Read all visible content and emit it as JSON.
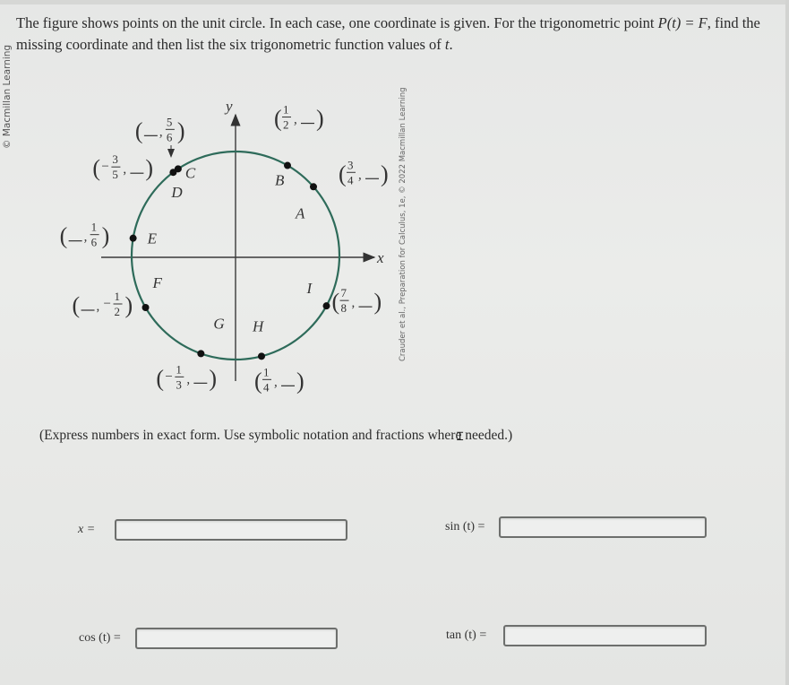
{
  "prompt": {
    "part1": "The figure shows points on the unit circle. In each case, one coordinate is given. For the trigonometric point ",
    "math_point": "P(t) = F",
    "part2": ", find the missing coordinate and then list the six trigonometric function values of ",
    "math_var": "t",
    "part3": "."
  },
  "side_credit": "© Macmillan Learning",
  "figure": {
    "credit": "Crauder et al., Preparation for Calculus, 1e, © 2022 Macmillan Learning",
    "x_axis_label": "x",
    "y_axis_label": "y",
    "circle_color": "#2e6b5a",
    "points": [
      {
        "name": "A",
        "given": "x",
        "label": "(3/4, __)",
        "num": "3",
        "den": "4",
        "sign": ""
      },
      {
        "name": "B",
        "given": "x",
        "label": "(1/2, __)",
        "num": "1",
        "den": "2",
        "sign": ""
      },
      {
        "name": "C",
        "given": "y",
        "label": "(__, 5/6)",
        "num": "5",
        "den": "6",
        "sign": ""
      },
      {
        "name": "D",
        "given": "x",
        "label": "(-3/5, __)",
        "num": "3",
        "den": "5",
        "sign": "−"
      },
      {
        "name": "E",
        "given": "y",
        "label": "(__, 1/6)",
        "num": "1",
        "den": "6",
        "sign": ""
      },
      {
        "name": "F",
        "given": "y",
        "label": "(__, -1/2)",
        "num": "1",
        "den": "2",
        "sign": "−"
      },
      {
        "name": "G",
        "given": "x",
        "label": "(-1/3, __)",
        "num": "1",
        "den": "3",
        "sign": "−"
      },
      {
        "name": "H",
        "given": "x",
        "label": "(1/4, __)",
        "num": "1",
        "den": "4",
        "sign": ""
      },
      {
        "name": "I",
        "given": "x",
        "label": "(7/8, __)",
        "num": "7",
        "den": "8",
        "sign": ""
      }
    ]
  },
  "instructions": "(Express numbers in exact form. Use symbolic notation and fractions where needed.)",
  "fields": {
    "x": {
      "label": "x =",
      "value": ""
    },
    "sin": {
      "label": "sin (t) =",
      "value": ""
    },
    "cos": {
      "label": "cos (t) =",
      "value": ""
    },
    "tan": {
      "label": "tan (t) =",
      "value": ""
    }
  }
}
